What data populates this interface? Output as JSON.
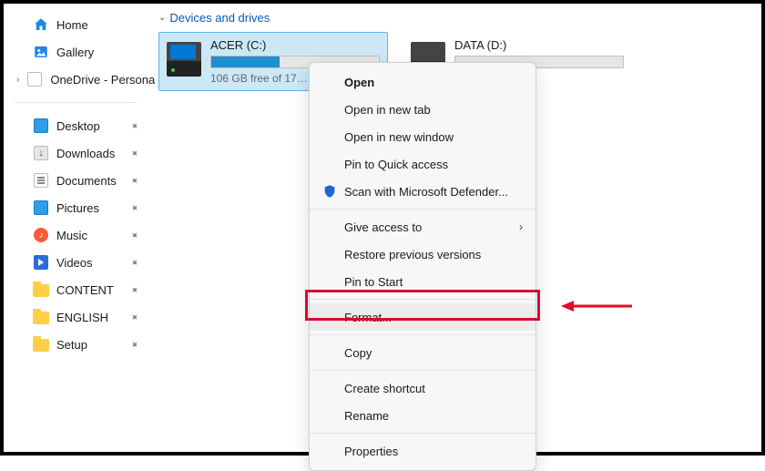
{
  "sidebar": {
    "home": "Home",
    "gallery": "Gallery",
    "onedrive": "OneDrive - Persona",
    "items": [
      {
        "label": "Desktop"
      },
      {
        "label": "Downloads"
      },
      {
        "label": "Documents"
      },
      {
        "label": "Pictures"
      },
      {
        "label": "Music"
      },
      {
        "label": "Videos"
      },
      {
        "label": "CONTENT"
      },
      {
        "label": "ENGLISH"
      },
      {
        "label": "Setup"
      }
    ]
  },
  "section_title": "Devices and drives",
  "drives": [
    {
      "name": "ACER (C:)",
      "free": "106 GB free of 17…",
      "fill_pct": 41
    },
    {
      "name": "DATA (D:)",
      "free": "",
      "fill_pct": 0
    }
  ],
  "context_menu": {
    "open": "Open",
    "open_new_tab": "Open in new tab",
    "open_new_window": "Open in new window",
    "pin_quick": "Pin to Quick access",
    "defender": "Scan with Microsoft Defender...",
    "give_access": "Give access to",
    "restore": "Restore previous versions",
    "pin_start": "Pin to Start",
    "format": "Format...",
    "copy": "Copy",
    "create_shortcut": "Create shortcut",
    "rename": "Rename",
    "properties": "Properties"
  }
}
